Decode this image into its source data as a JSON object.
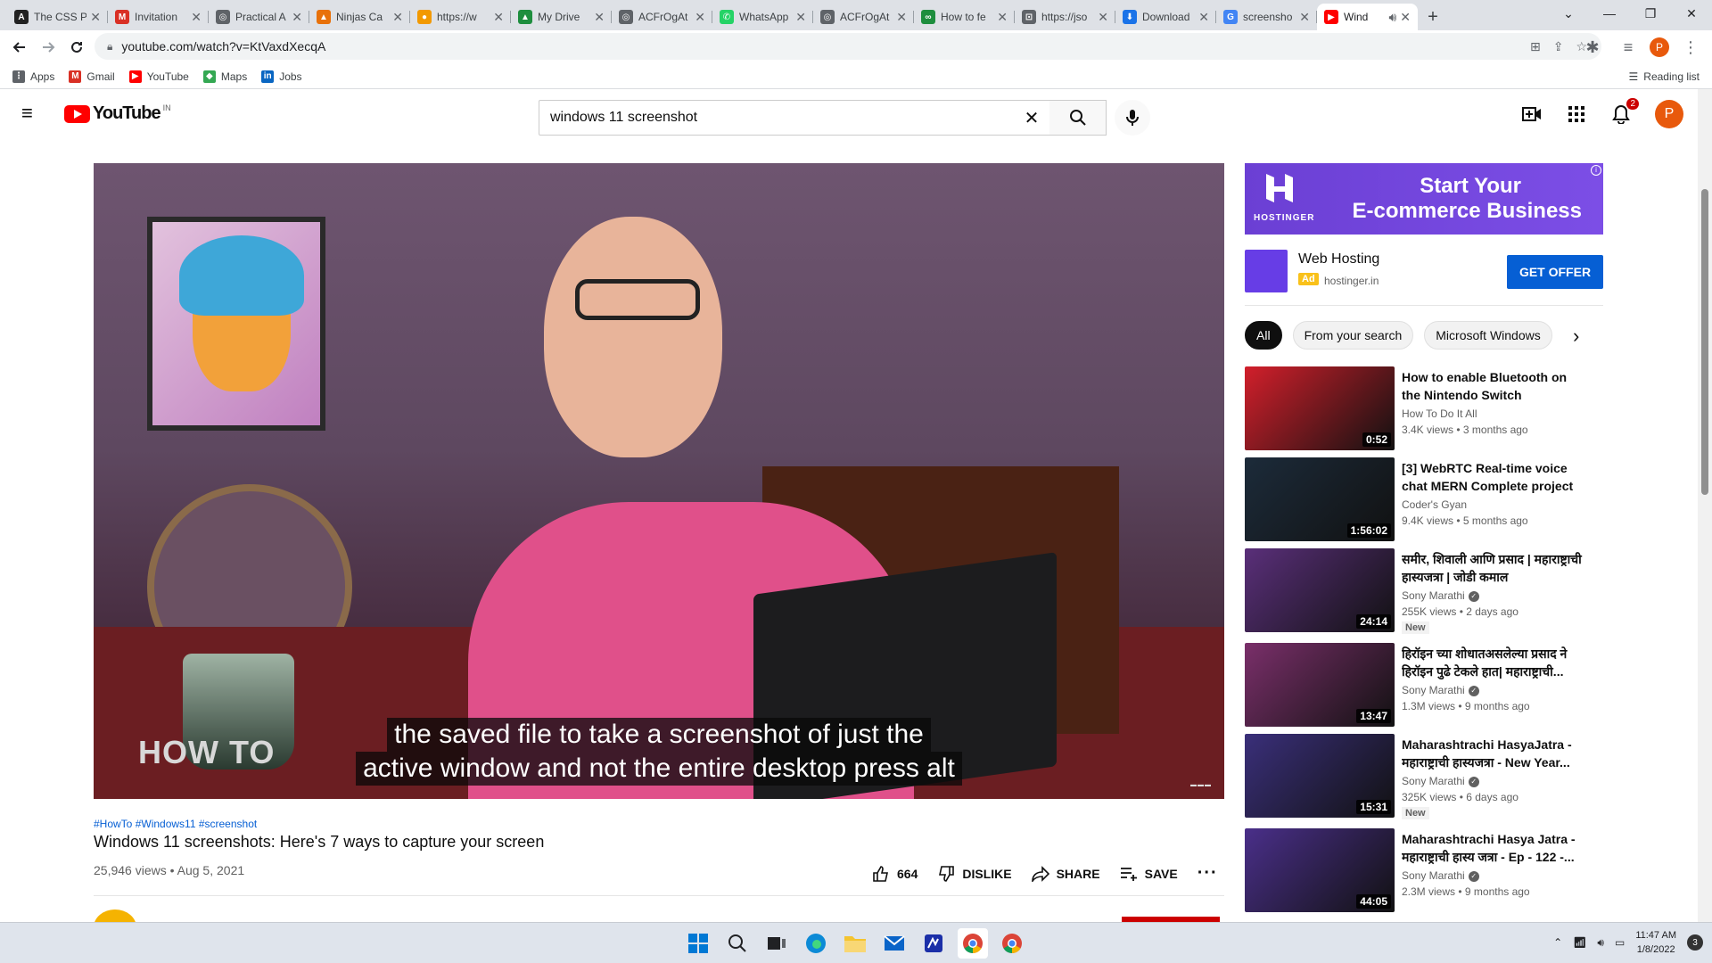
{
  "browser": {
    "tabs": [
      {
        "title": "The CSS P",
        "color": "#222222",
        "icon": "A"
      },
      {
        "title": "Invitation",
        "color": "#d93025",
        "icon": "M"
      },
      {
        "title": "Practical A",
        "color": "#5f6368",
        "icon": "◎"
      },
      {
        "title": "Ninjas Ca",
        "color": "#e8710a",
        "icon": "▲"
      },
      {
        "title": "https://w",
        "color": "#f29900",
        "icon": "●"
      },
      {
        "title": "My Drive",
        "color": "#1e8e3e",
        "icon": "▲"
      },
      {
        "title": "ACFrOgAt",
        "color": "#5f6368",
        "icon": "◎"
      },
      {
        "title": "WhatsApp",
        "color": "#25d366",
        "icon": "✆"
      },
      {
        "title": "ACFrOgAt",
        "color": "#5f6368",
        "icon": "◎"
      },
      {
        "title": "How to fe",
        "color": "#1e8e3e",
        "icon": "∞"
      },
      {
        "title": "https://jso",
        "color": "#5f6368",
        "icon": "⊡"
      },
      {
        "title": "Download",
        "color": "#1a73e8",
        "icon": "⬇"
      },
      {
        "title": "screensho",
        "color": "#4285f4",
        "icon": "G"
      },
      {
        "title": "Wind",
        "color": "#ff0000",
        "icon": "▶",
        "active": true
      }
    ],
    "url": "youtube.com/watch?v=KtVaxdXecqA",
    "bookmarks": [
      {
        "label": "Apps",
        "color": "#5f6368",
        "icon": "⋮"
      },
      {
        "label": "Gmail",
        "color": "#d93025",
        "icon": "M"
      },
      {
        "label": "YouTube",
        "color": "#ff0000",
        "icon": "▶"
      },
      {
        "label": "Maps",
        "color": "#34a853",
        "icon": "◆"
      },
      {
        "label": "Jobs",
        "color": "#0a66c2",
        "icon": "in"
      }
    ],
    "reading_list": "Reading list"
  },
  "youtube": {
    "logo_text": "YouTube",
    "country_code": "IN",
    "search_query": "windows 11 screenshot",
    "notifications_count": "2",
    "avatar_letter": "P"
  },
  "video": {
    "caption_line1": "the saved file to take a screenshot of just the",
    "caption_line2": "active window and not the entire desktop press alt",
    "overlay_text": "HOW TO",
    "hashtags": "#HowTo #Windows11 #screenshot",
    "title": "Windows 11 screenshots: Here's 7 ways to capture your screen",
    "meta": "25,946 views • Aug 5, 2021",
    "likes": "664",
    "dislike_label": "DISLIKE",
    "share_label": "SHARE",
    "save_label": "SAVE"
  },
  "ad": {
    "banner_line1": "Start Your",
    "banner_line2": "E-commerce Business",
    "brand": "HOSTINGER",
    "name": "Web Hosting",
    "badge": "Ad",
    "domain": "hostinger.in",
    "cta": "GET OFFER"
  },
  "chips": [
    "All",
    "From your search",
    "Microsoft Windows"
  ],
  "related": [
    {
      "title": "How to enable Bluetooth on the Nintendo Switch",
      "channel": "How To Do It All",
      "meta": "3.4K views • 3 months ago",
      "duration": "0:52",
      "verified": false,
      "new": false,
      "thumb": "#d21f2b"
    },
    {
      "title": "[3] WebRTC Real-time voice chat MERN Complete project i...",
      "channel": "Coder's Gyan",
      "meta": "9.4K views • 5 months ago",
      "duration": "1:56:02",
      "verified": false,
      "new": false,
      "thumb": "#1c2b3a"
    },
    {
      "title": "समीर, शिवाली आणि प्रसाद | महाराष्ट्राची हास्यजत्रा | जोडी कमाल",
      "channel": "Sony Marathi",
      "meta": "255K views • 2 days ago",
      "duration": "24:14",
      "verified": true,
      "new": true,
      "thumb": "#5a2f7a"
    },
    {
      "title": "हिरॉइन च्या शोधातअसलेल्या प्रसाद ने हिरॉइन पुढे टेकले हात| महाराष्ट्राची...",
      "channel": "Sony Marathi",
      "meta": "1.3M views • 9 months ago",
      "duration": "13:47",
      "verified": true,
      "new": false,
      "thumb": "#7a2f6a"
    },
    {
      "title": "Maharashtrachi HasyaJatra - महाराष्ट्राची हास्यजत्रा - New Year...",
      "channel": "Sony Marathi",
      "meta": "325K views • 6 days ago",
      "duration": "15:31",
      "verified": true,
      "new": true,
      "thumb": "#3a2f7a"
    },
    {
      "title": "Maharashtrachi Hasya Jatra - महाराष्ट्राची हास्य जत्रा - Ep - 122 -...",
      "channel": "Sony Marathi",
      "meta": "2.3M views • 9 months ago",
      "duration": "44:05",
      "verified": true,
      "new": false,
      "thumb": "#4a2f8a"
    }
  ],
  "new_label": "New",
  "taskbar": {
    "time": "11:47 AM",
    "date": "1/8/2022",
    "tray_count": "3"
  }
}
